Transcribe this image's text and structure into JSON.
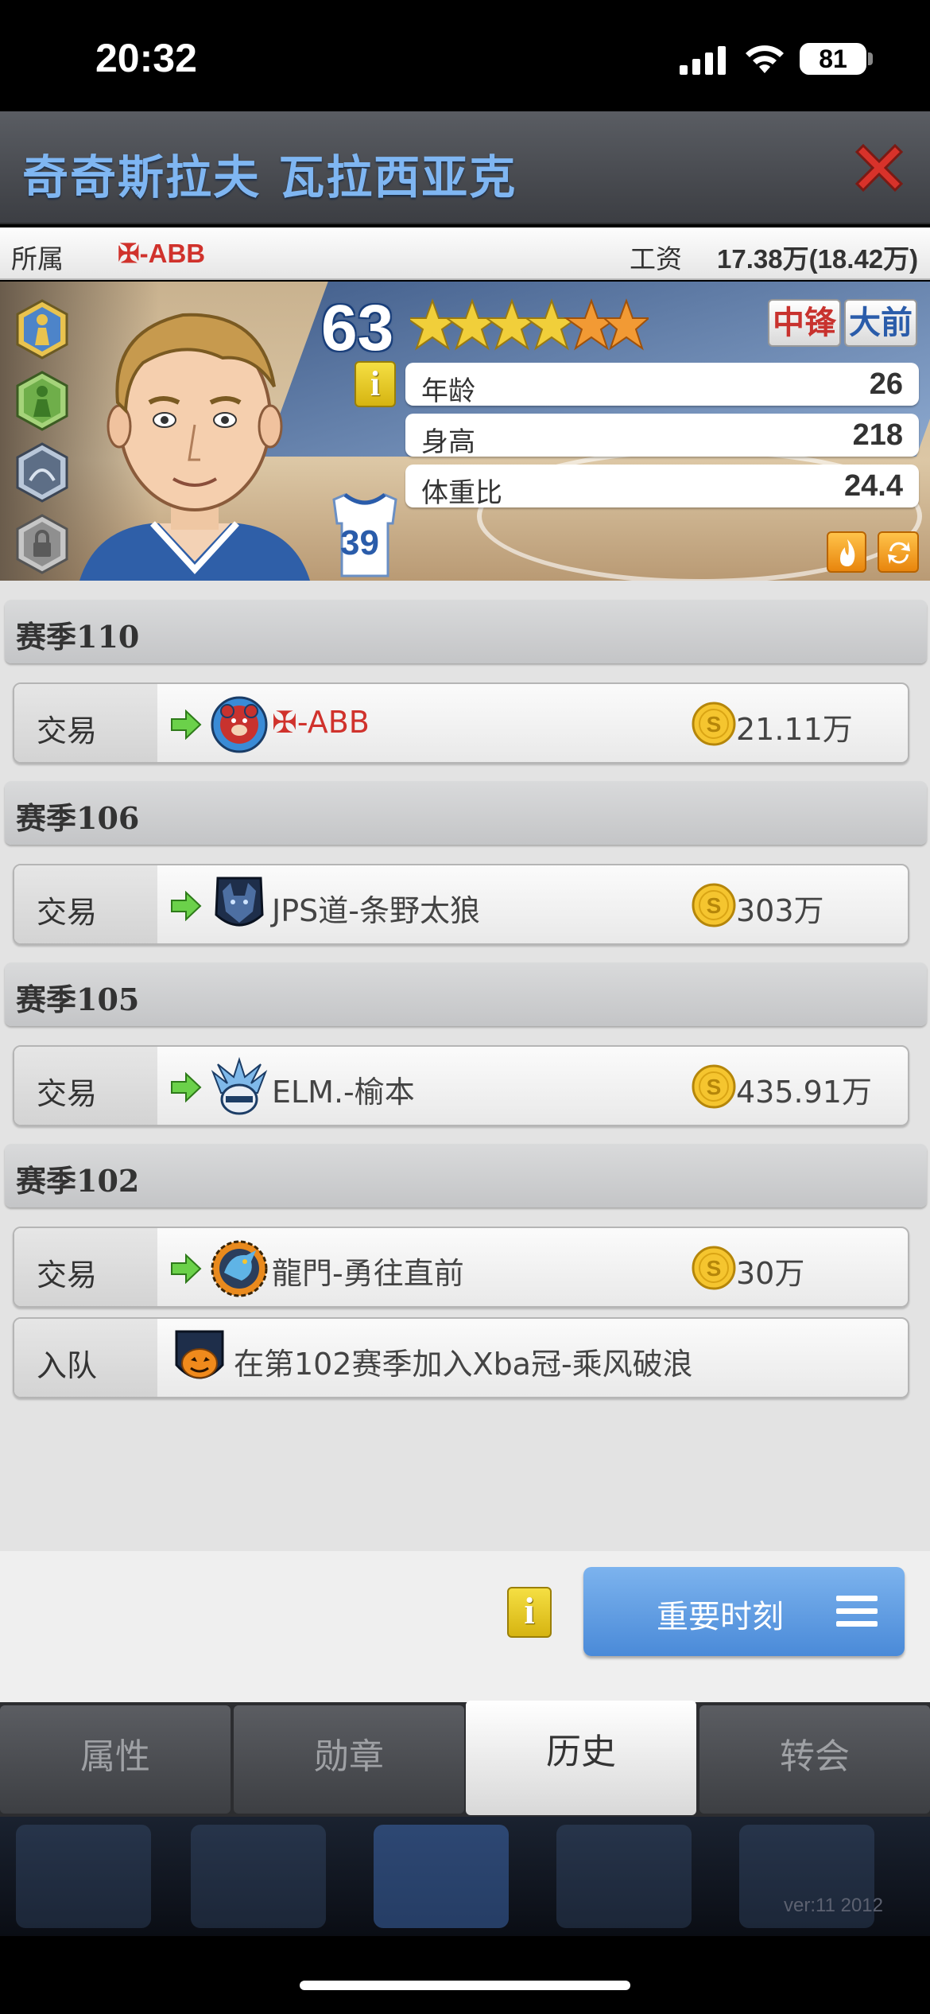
{
  "status_bar": {
    "time": "20:32",
    "battery": "81"
  },
  "header": {
    "player_name": "奇奇斯拉夫 瓦拉西亚克"
  },
  "info_strip": {
    "team_label": "所属",
    "team": "✠-ABB",
    "salary_label": "工资",
    "salary": "17.38万(18.42万)"
  },
  "player": {
    "rating": "63",
    "stars_full": 4,
    "stars_half_orange": 2,
    "positions": [
      "中锋",
      "大前"
    ],
    "stats": [
      {
        "label": "年龄",
        "value": "26"
      },
      {
        "label": "身高",
        "value": "218"
      },
      {
        "label": "体重比",
        "value": "24.4"
      }
    ],
    "jersey_number": "39"
  },
  "history": [
    {
      "season": "赛季110",
      "entries": [
        {
          "type": "交易",
          "team": "✠-ABB",
          "team_color": "#d0322c",
          "logo": "bear-logo",
          "price": "21.11万"
        }
      ]
    },
    {
      "season": "赛季106",
      "entries": [
        {
          "type": "交易",
          "team": "JPS道-条野太狼",
          "logo": "wolf-logo",
          "price": "303万"
        }
      ]
    },
    {
      "season": "赛季105",
      "entries": [
        {
          "type": "交易",
          "team": "ELM.-榆本",
          "logo": "winged-helmet-logo",
          "price": "435.91万"
        }
      ]
    },
    {
      "season": "赛季102",
      "entries": [
        {
          "type": "交易",
          "team": "龍門-勇往直前",
          "logo": "dragon-logo",
          "price": "30万"
        },
        {
          "type": "入队",
          "team": "在第102赛季加入Xba冠-乘风破浪",
          "logo": "pumpkin-logo"
        }
      ]
    }
  ],
  "actions": {
    "info": "i",
    "moments_label": "重要时刻"
  },
  "tabs": [
    {
      "label": "属性",
      "active": false
    },
    {
      "label": "勋章",
      "active": false
    },
    {
      "label": "历史",
      "active": true
    },
    {
      "label": "转会",
      "active": false
    }
  ],
  "footer": {
    "version": "ver:11  2012"
  },
  "colors": {
    "title_blue": "#7fb6f2",
    "team_red": "#d0322c",
    "button_blue": "#4a8ad8"
  }
}
